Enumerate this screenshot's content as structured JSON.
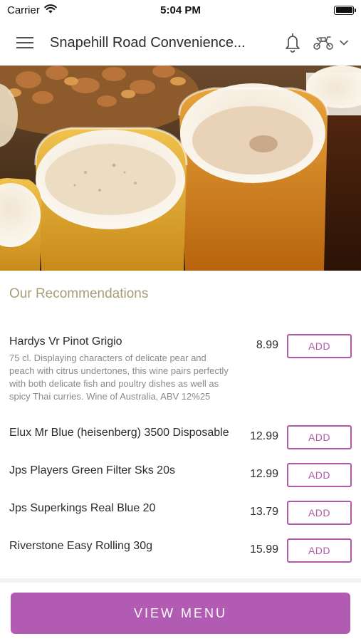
{
  "status_bar": {
    "carrier": "Carrier",
    "time": "5:04 PM",
    "wifi_icon": "wifi-icon",
    "battery_icon": "battery-icon"
  },
  "header": {
    "title": "Snapehill Road Convenience...",
    "menu_icon": "hamburger-icon",
    "bell_icon": "bell-icon",
    "delivery_icon": "scooter-icon",
    "dropdown_icon": "chevron-down-icon"
  },
  "hero": {
    "image": "beer-glasses-photo"
  },
  "recommendations": {
    "title": "Our Recommendations",
    "items": [
      {
        "name": "Hardys Vr Pinot Grigio",
        "description": "75 cl. Displaying characters of delicate pear and peach with citrus undertones, this wine pairs perfectly with both delicate fish and poultry dishes as well as spicy Thai curries. Wine of Australia, ABV 12%25",
        "price": "8.99",
        "add_label": "ADD"
      },
      {
        "name": "Elux Mr Blue (heisenberg) 3500 Disposable",
        "description": "",
        "price": "12.99",
        "add_label": "ADD"
      },
      {
        "name": "Jps Players Green Filter Sks 20s",
        "description": "",
        "price": "12.99",
        "add_label": "ADD"
      },
      {
        "name": "Jps Superkings Real Blue 20",
        "description": "",
        "price": "13.79",
        "add_label": "ADD"
      },
      {
        "name": "Riverstone Easy Rolling 30g",
        "description": "",
        "price": "15.99",
        "add_label": "ADD"
      }
    ]
  },
  "footer": {
    "view_menu_label": "VIEW MENU"
  },
  "colors": {
    "accent": "#b25bb2",
    "section_title": "#a99a78"
  }
}
